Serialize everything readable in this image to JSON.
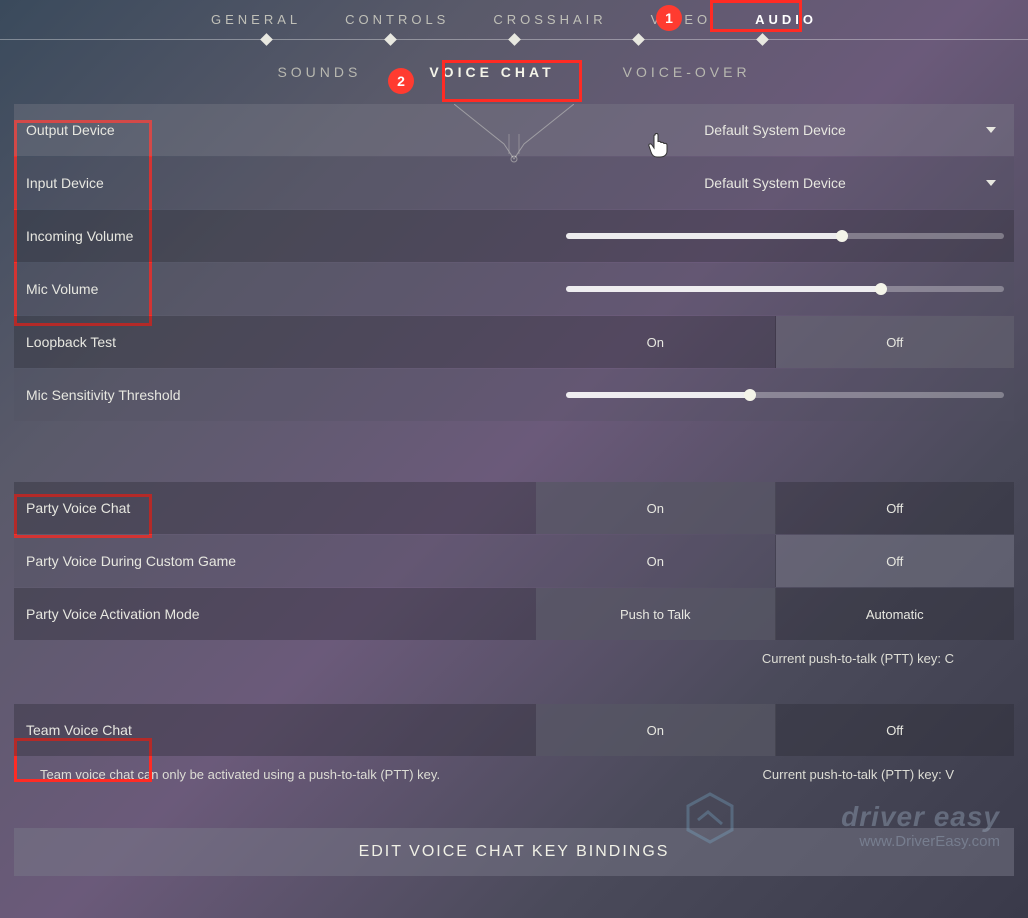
{
  "top_nav": {
    "general": "GENERAL",
    "controls": "CONTROLS",
    "crosshair": "CROSSHAIR",
    "video": "VIDEO",
    "audio": "AUDIO"
  },
  "sub_nav": {
    "sounds": "SOUNDS",
    "voice_chat": "VOICE CHAT",
    "voice_over": "VOICE-OVER"
  },
  "callouts": {
    "badge1": "1",
    "badge2": "2"
  },
  "rows": {
    "output_device": {
      "label": "Output Device",
      "value": "Default System Device"
    },
    "input_device": {
      "label": "Input Device",
      "value": "Default System Device"
    },
    "incoming_volume": {
      "label": "Incoming Volume",
      "percent": 63
    },
    "mic_volume": {
      "label": "Mic Volume",
      "percent": 72
    },
    "loopback_test": {
      "label": "Loopback Test",
      "on": "On",
      "off": "Off",
      "active": "off"
    },
    "mic_sens": {
      "label": "Mic Sensitivity Threshold",
      "percent": 42
    },
    "party_voice": {
      "label": "Party Voice Chat",
      "on": "On",
      "off": "Off",
      "active": "on"
    },
    "party_custom": {
      "label": "Party Voice During Custom Game",
      "on": "On",
      "off": "Off",
      "active": "off"
    },
    "party_mode": {
      "label": "Party Voice Activation Mode",
      "left": "Push to Talk",
      "right": "Automatic",
      "active": "left"
    },
    "team_voice": {
      "label": "Team Voice Chat",
      "on": "On",
      "off": "Off",
      "active": "on"
    }
  },
  "info": {
    "party_ptt": "Current push-to-talk (PTT) key: C",
    "team_note": "Team voice chat can only be activated using a push-to-talk (PTT) key.",
    "team_ptt": "Current push-to-talk (PTT) key: V"
  },
  "edit_button": "EDIT VOICE CHAT KEY BINDINGS",
  "watermark": {
    "line1": "driver easy",
    "line2": "www.DriverEasy.com"
  }
}
